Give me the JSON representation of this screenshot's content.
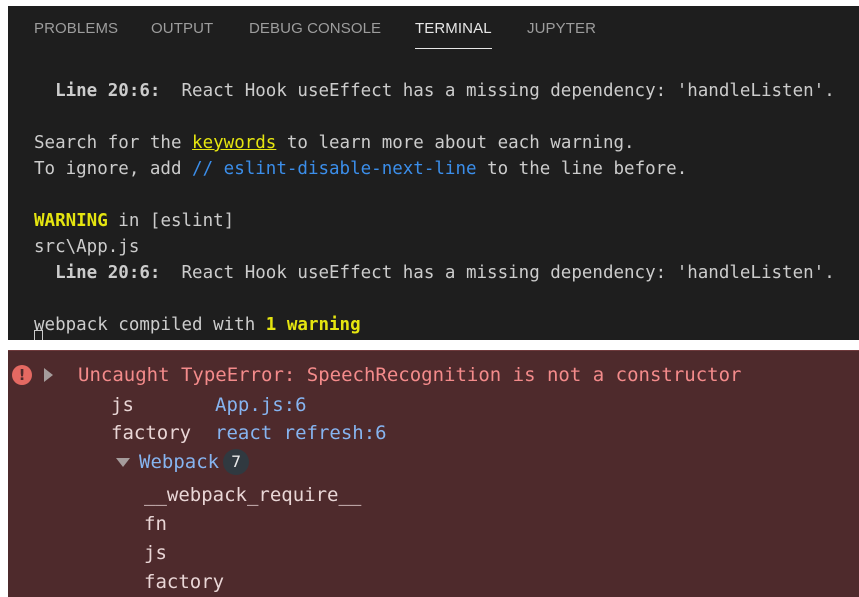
{
  "panel": {
    "tabs": [
      "PROBLEMS",
      "OUTPUT",
      "DEBUG CONSOLE",
      "TERMINAL",
      "JUPYTER"
    ],
    "active_tab": "TERMINAL"
  },
  "terminal": {
    "l1_prefix": "  Line 20:6:",
    "l1_text": "  React Hook useEffect has a missing dependency: 'handleListen'.",
    "l3_a": "Search for the ",
    "l3_keyword": "keywords",
    "l3_b": " to learn more about each warning.",
    "l4_a": "To ignore, add ",
    "l4_comment": "// eslint-disable-next-line",
    "l4_b": " to the line before.",
    "l6_warning": "WARNING",
    "l6_rest": " in [eslint]",
    "l7_file": "src\\App.js",
    "l8_prefix": "  Line 20:6:",
    "l8_text": "  React Hook useEffect has a missing dependency: 'handleListen'.",
    "l10_a": "webpack compiled with ",
    "l10_count": "1 warning"
  },
  "devtools": {
    "error_message": "Uncaught TypeError: SpeechRecognition is not a constructor",
    "frames": [
      {
        "name": "js",
        "location": "App.js:6"
      },
      {
        "name": "factory",
        "location": "react refresh:6"
      }
    ],
    "group_label": "Webpack",
    "group_count": "7",
    "group_frames": [
      "__webpack_require__",
      "fn",
      "js",
      "factory"
    ]
  },
  "colors": {
    "terminal_bg": "#1e1e1e",
    "warning_yellow": "#e5e510",
    "comment_blue": "#3b8eea",
    "error_bg": "#4e2a2c",
    "error_red": "#f48b8b",
    "link_blue": "#86b4f0"
  }
}
